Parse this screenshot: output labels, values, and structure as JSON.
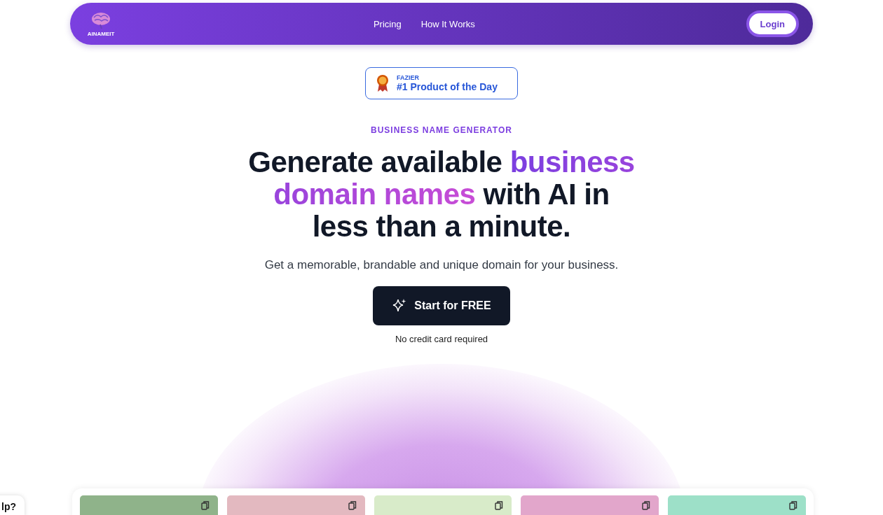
{
  "nav": {
    "logo_text": "AINAMEIT",
    "links": [
      {
        "label": "Pricing"
      },
      {
        "label": "How It Works"
      }
    ],
    "login": "Login"
  },
  "badge": {
    "source": "FAZIER",
    "title": "#1 Product of the Day"
  },
  "eyebrow": "BUSINESS NAME GENERATOR",
  "headline": [
    {
      "text": "Generate available ",
      "highlight": false
    },
    {
      "text": "business domain names",
      "highlight": true
    },
    {
      "text": " with AI in less than a minute.",
      "highlight": false
    }
  ],
  "subtitle": "Get a memorable, brandable and unique domain for your business.",
  "cta": {
    "label": "Start for FREE",
    "note": "No credit card required"
  },
  "cards": [
    {
      "color": "#8fb38a"
    },
    {
      "color": "#e3b9c0"
    },
    {
      "color": "#d8ebc9"
    },
    {
      "color": "#e2a6cb"
    },
    {
      "color": "#9de0c8"
    }
  ],
  "help": {
    "label": "lp?"
  }
}
